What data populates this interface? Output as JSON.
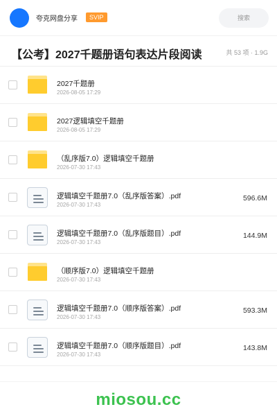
{
  "header": {
    "brand": "夸克网盘分享",
    "badge": "SVIP",
    "search_label": "搜索"
  },
  "share": {
    "title": "【公考】2027千题册语句表达片段阅读",
    "meta": "共 53 项 · 1.9G"
  },
  "files": [
    {
      "type": "folder",
      "name": "2027千题册",
      "date": "2026-08-05 17:29",
      "size": ""
    },
    {
      "type": "folder",
      "name": "2027逻辑填空千题册",
      "date": "2026-08-05 17:29",
      "size": ""
    },
    {
      "type": "folder",
      "name": "（乱序版7.0）逻辑填空千题册",
      "date": "2026-07-30 17:43",
      "size": ""
    },
    {
      "type": "file",
      "name": "逻辑填空千题册7.0（乱序版答案）.pdf",
      "date": "2026-07-30 17:43",
      "size": "596.6M"
    },
    {
      "type": "file",
      "name": "逻辑填空千题册7.0（乱序版题目）.pdf",
      "date": "2026-07-30 17:43",
      "size": "144.9M"
    },
    {
      "type": "folder",
      "name": "（顺序版7.0）逻辑填空千题册",
      "date": "2026-07-30 17:43",
      "size": ""
    },
    {
      "type": "file",
      "name": "逻辑填空千题册7.0（顺序版答案）.pdf",
      "date": "2026-07-30 17:43",
      "size": "593.3M"
    },
    {
      "type": "file",
      "name": "逻辑填空千题册7.0（顺序版题目）.pdf",
      "date": "2026-07-30 17:43",
      "size": "143.8M"
    }
  ],
  "footer": {
    "watermark": "miosou.cc"
  },
  "colors": {
    "accent": "#1677ff",
    "badge": "#ff9a2e",
    "folder": "#ffcc2e",
    "watermark": "#3cc24f"
  }
}
